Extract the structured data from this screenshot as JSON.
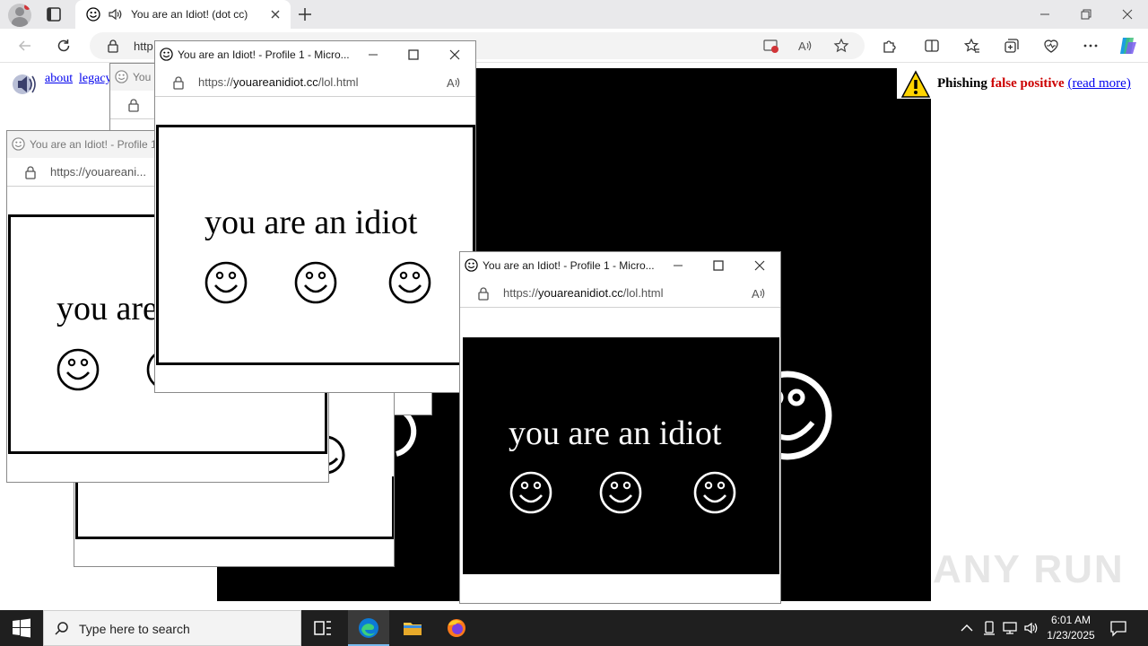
{
  "browser": {
    "tab_title": "You are an Idiot! (dot cc)",
    "address_partial": "http"
  },
  "page": {
    "links": [
      "about",
      "legacy"
    ],
    "big_text": "idiot",
    "phishing": {
      "word1": "Phishing",
      "word2": "false positive",
      "link": "(read more)"
    }
  },
  "popups": [
    {
      "title": "You",
      "url_host": "",
      "url_path": "",
      "content_text": ""
    },
    {
      "title": "You are an Idiot! - Profile 1",
      "url_host": "https://youareani...",
      "url_path": "",
      "content_text": "you are"
    },
    {
      "title": "You are an Idiot! - Profile 1 - Micro...",
      "url_prefix": "https://",
      "url_host": "youareanidiot.cc",
      "url_path": "/lol.html",
      "content_text": "you are an idiot"
    },
    {
      "title": "You are an Idiot! - Profile 1 - Micro...",
      "url_prefix": "https://",
      "url_host": "youareanidiot.cc",
      "url_path": "/lol.html",
      "content_text": "you are an idiot"
    }
  ],
  "taskbar": {
    "search_placeholder": "Type here to search",
    "time": "6:01 AM",
    "date": "1/23/2025"
  },
  "watermark": "ANY RUN",
  "icons": [
    "profile-icon",
    "tab-actions-icon",
    "smiley-favicon-icon",
    "speaker-icon",
    "close-icon",
    "plus-icon",
    "minimize-icon",
    "restore-icon",
    "back-icon",
    "refresh-icon",
    "lock-icon",
    "read-aloud-icon",
    "favorite-icon",
    "extensions-icon",
    "split-screen-icon",
    "favorites-icon",
    "collections-icon",
    "browser-essentials-icon",
    "more-icon",
    "copilot-icon",
    "warning-icon",
    "windows-start-icon",
    "search-icon",
    "task-view-icon",
    "edge-icon",
    "file-explorer-icon",
    "firefox-icon",
    "chevron-up-icon",
    "network-icon",
    "volume-icon",
    "notification-icon"
  ]
}
